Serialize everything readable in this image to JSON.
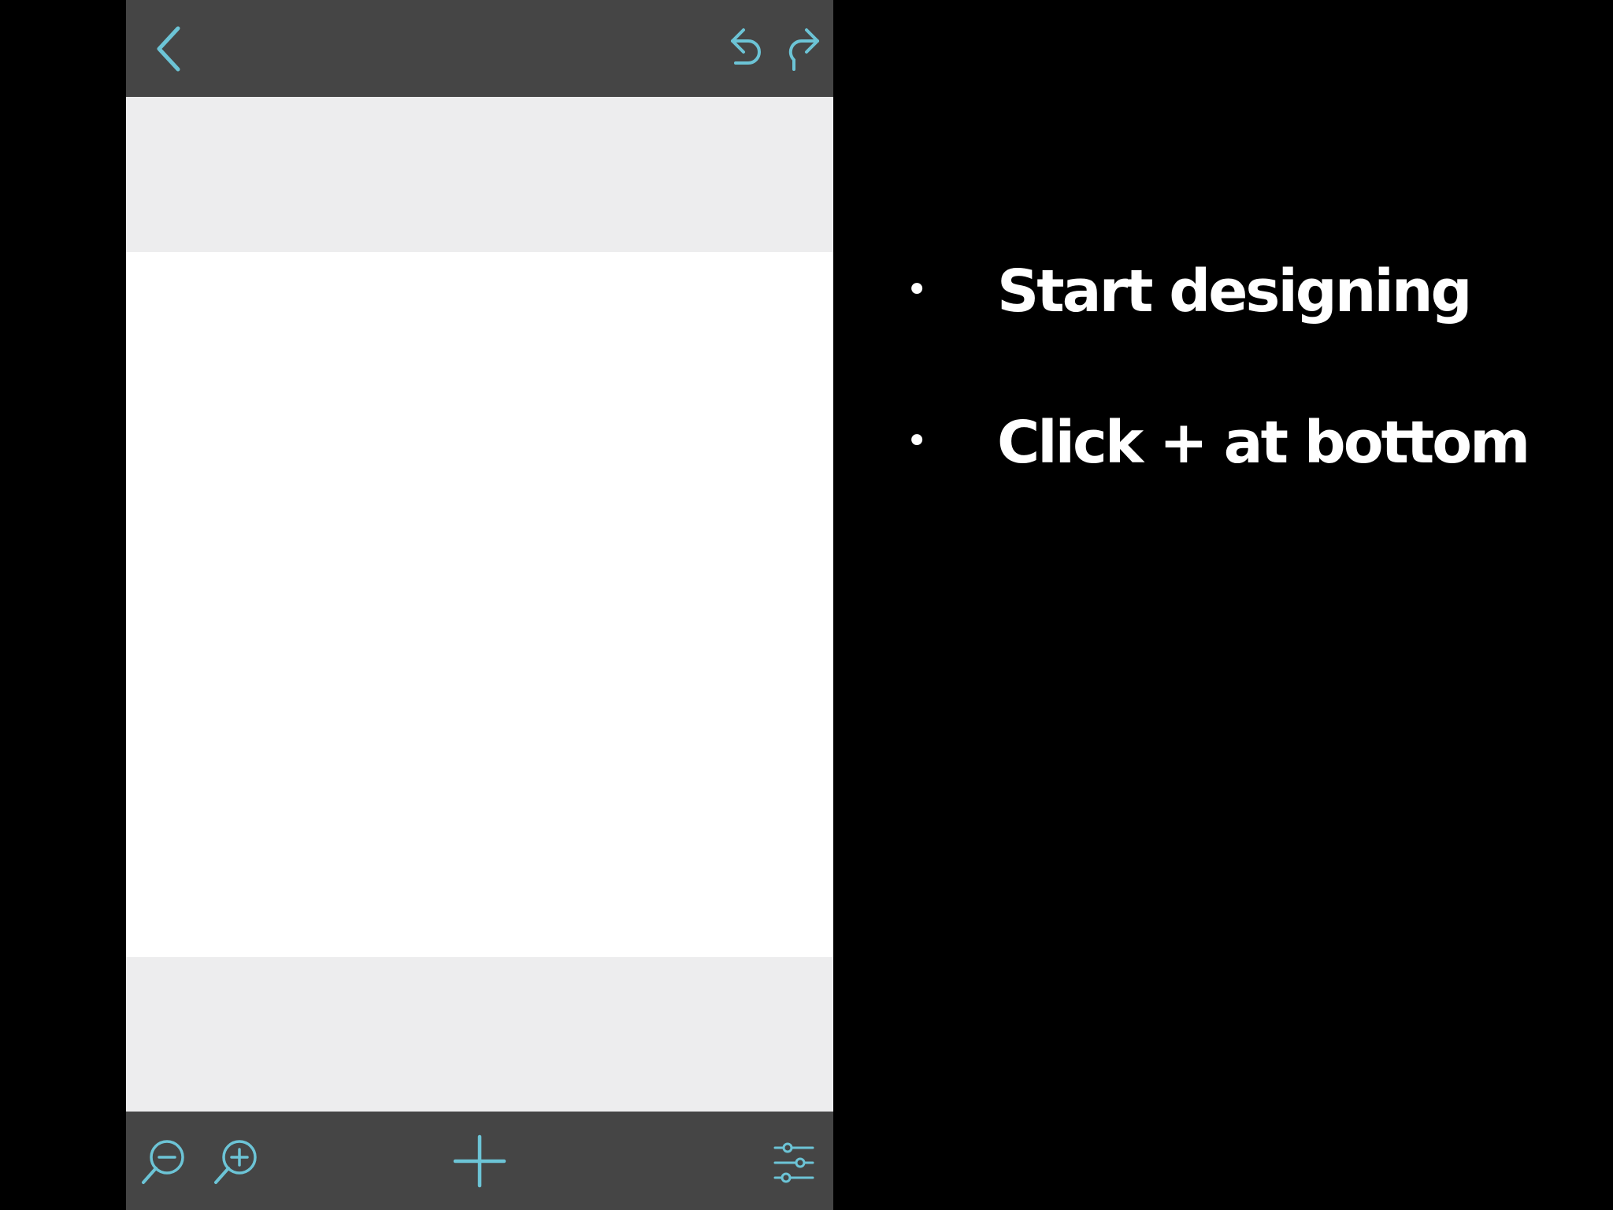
{
  "app": {
    "accent_color": "#6cc4d6",
    "toolbar_color": "#454545",
    "canvas_background": "#ededee",
    "artboard_color": "#ffffff"
  },
  "top_bar": {
    "back_icon": "chevron-left-icon",
    "undo_icon": "undo-icon",
    "redo_icon": "redo-icon"
  },
  "bottom_bar": {
    "zoom_out_icon": "zoom-out-icon",
    "zoom_in_icon": "zoom-in-icon",
    "add_icon": "plus-icon",
    "settings_icon": "sliders-icon"
  },
  "instructions": {
    "bullet": "•",
    "items": [
      "Start designing",
      "Click + at bottom"
    ]
  }
}
